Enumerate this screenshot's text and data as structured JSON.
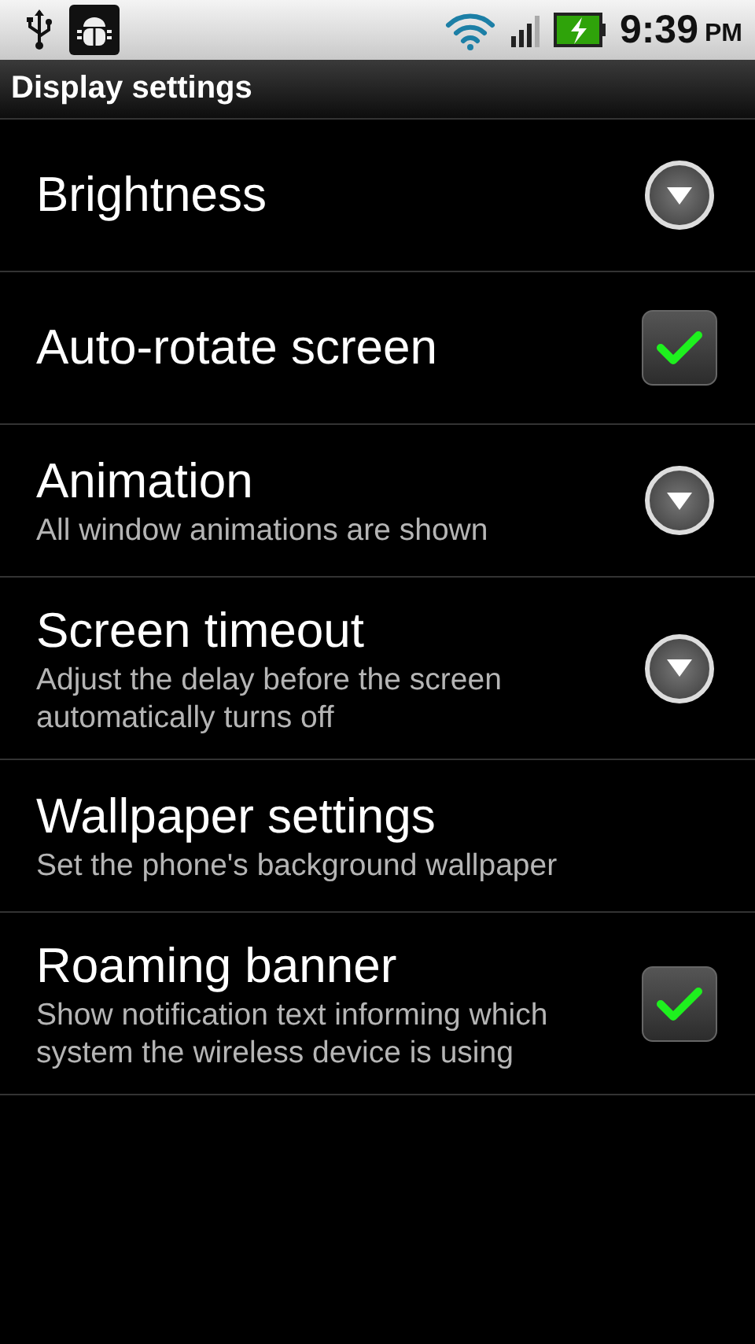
{
  "status_bar": {
    "time": "9:39",
    "ampm": "PM"
  },
  "title_bar": {
    "title": "Display settings"
  },
  "settings": [
    {
      "kind": "dropdown",
      "title": "Brightness"
    },
    {
      "kind": "checkbox",
      "title": "Auto-rotate screen",
      "checked": true
    },
    {
      "kind": "dropdown",
      "title": "Animation",
      "summary": "All window animations are shown"
    },
    {
      "kind": "dropdown",
      "title": "Screen timeout",
      "summary": "Adjust the delay before the screen automatically turns off"
    },
    {
      "kind": "plain",
      "title": "Wallpaper settings",
      "summary": "Set the phone's background wallpaper"
    },
    {
      "kind": "checkbox",
      "title": "Roaming banner",
      "summary": "Show notification text informing which system the wireless device is using",
      "checked": true
    }
  ]
}
